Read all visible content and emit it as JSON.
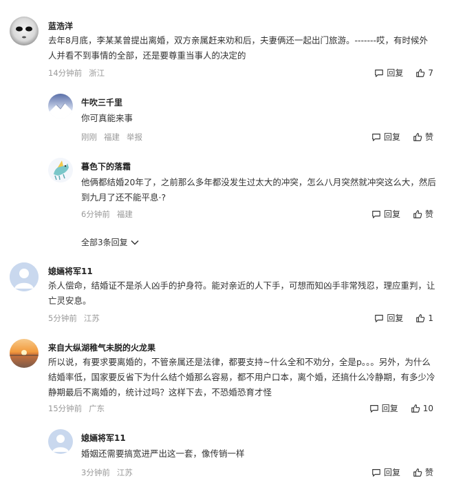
{
  "comments": [
    {
      "name": "蓝浩洋",
      "text_line1": "去年8月底，李某某曾提出离婚，双方亲属赶来劝和后，夫妻俩还一起出门旅游。-------哎，有时候外",
      "text_line2": "人并看不到事情的全部，还是要尊重当事人的决定的",
      "time": "14分钟前",
      "location": "浙江",
      "reply_label": "回复",
      "like_count": "7",
      "replies": [
        {
          "name": "牛吹三千里",
          "text": "你可真能来事",
          "time": "刚刚",
          "location": "福建",
          "report_label": "举报",
          "reply_label": "回复",
          "like_label": "赞"
        },
        {
          "name": "暮色下的落霜",
          "text_line1": "他俩都结婚20年了，之前那么多年都没发生过太大的冲突，怎么八月突然就冲突这么大，然后",
          "text_line2": "到九月了还不能平息·?",
          "time": "6分钟前",
          "location": "福建",
          "reply_label": "回复",
          "like_label": "赞"
        }
      ],
      "expand_label": "全部3条回复"
    },
    {
      "name": "媳婳将军11",
      "text_line1": "杀人偿命，结婚证不是杀人凶手的护身符。能对亲近的人下手，可想而知凶手非常残忍，理应重判，让",
      "text_line2": "亡灵安息。",
      "time": "5分钟前",
      "location": "江苏",
      "reply_label": "回复",
      "like_count": "1"
    },
    {
      "name": "来自大纵湖稚气未脱的火龙果",
      "text_line1": "所以说，有要求要离婚的，不管亲属还是法律，都要支持~什么全和不劝分，全是p。。。另外，为什么",
      "text_line2": "结婚率低，国家要反省下为什么结个婚那么容易，都不用户口本，离个婚，还搞什么冷静期，有多少冷",
      "text_line3": "静期最后不离婚的，统计过吗？这样下去，不恐婚恐育才怪",
      "time": "15分钟前",
      "location": "广东",
      "reply_label": "回复",
      "like_count": "10",
      "replies": [
        {
          "name": "媳婳将军11",
          "text": "婚姻还需要搞宽进严出这一套，像传销一样",
          "time": "3分钟前",
          "location": "江苏",
          "reply_label": "回复",
          "like_label": "赞"
        }
      ]
    }
  ],
  "colors": {
    "name": "#222222",
    "meta": "#999999",
    "body": "#333333"
  }
}
